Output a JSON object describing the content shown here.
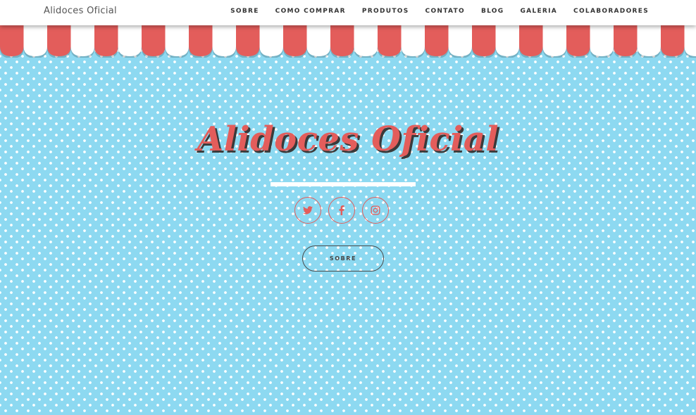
{
  "navbar": {
    "brand": "Alidoces Oficial",
    "items": [
      {
        "label": "SOBRE"
      },
      {
        "label": "COMO COMPRAR"
      },
      {
        "label": "PRODUTOS"
      },
      {
        "label": "CONTATO"
      },
      {
        "label": "BLOG"
      },
      {
        "label": "GALERIA"
      },
      {
        "label": "COLABORADORES"
      }
    ]
  },
  "hero": {
    "title": "Alidoces Oficial",
    "cta_label": "SOBRE",
    "socials": [
      {
        "icon": "twitter-icon"
      },
      {
        "icon": "facebook-icon"
      },
      {
        "icon": "instagram-icon"
      }
    ]
  },
  "colors": {
    "background": "#8dd9f1",
    "dots": "#ffffff",
    "awning_red": "#e35d5b",
    "awning_white": "#ffffff",
    "title": "#e35d5b",
    "title_shadow": "#3a3a3a"
  }
}
